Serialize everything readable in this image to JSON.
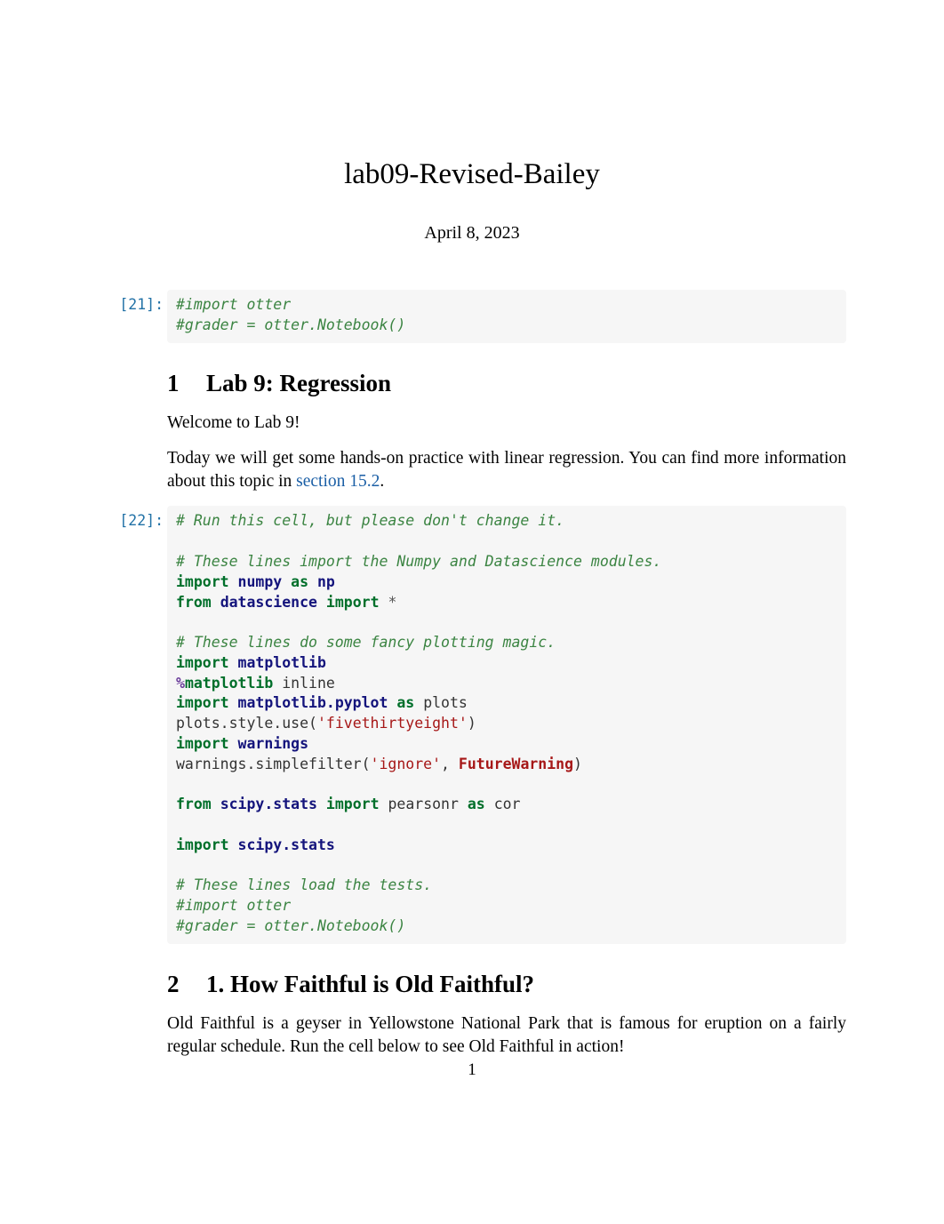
{
  "title": "lab09-Revised-Bailey",
  "date": "April 8, 2023",
  "cells": {
    "c1": {
      "prompt": "[21]:",
      "t_comment1": "#import otter",
      "t_comment2": "#grader = otter.Notebook()"
    },
    "c2": {
      "prompt": "[22]:",
      "line1": "# Run this cell, but please don't change it.",
      "line2": "# These lines import the Numpy and Datascience modules.",
      "kw_import": "import",
      "kw_from": "from",
      "kw_as": "as",
      "np_numpy": "numpy",
      "np_alias": "np",
      "ds": "datascience",
      "star": "*",
      "line3": "# These lines do some fancy plotting magic.",
      "mpl": "matplotlib",
      "magic_pct": "%",
      "magic_mpl": "matplotlib",
      "magic_inline": "inline",
      "mpl_pyplot": "matplotlib.pyplot",
      "plots_alias": "plots",
      "plots_style_use": "plots.style.use(",
      "fte": "'fivethirtyeight'",
      "close_paren": ")",
      "warnings": "warnings",
      "warnings_simplefilter": "warnings.simplefilter(",
      "ignore": "'ignore'",
      "comma_space": ", ",
      "fw": "FutureWarning",
      "scipy_stats": "scipy.stats",
      "pearsonr": "pearsonr",
      "cor": "cor",
      "scipy_stats2": "scipy.stats",
      "line4": "# These lines load the tests.",
      "line5": "#import otter",
      "line6": "#grader = otter.Notebook()"
    }
  },
  "sections": {
    "s1": {
      "num": "1",
      "title": "Lab 9: Regression"
    },
    "s2": {
      "num": "2",
      "title": "1. How Faithful is Old Faithful?"
    }
  },
  "paras": {
    "p1": "Welcome to Lab 9!",
    "p2a": "Today we will get some hands-on practice with linear regression. You can find more information about this topic in ",
    "p2_link": "section 15.2",
    "p2b": ".",
    "p3": "Old Faithful is a geyser in Yellowstone National Park that is famous for eruption on a fairly regular schedule. Run the cell below to see Old Faithful in action!"
  },
  "page_number": "1"
}
